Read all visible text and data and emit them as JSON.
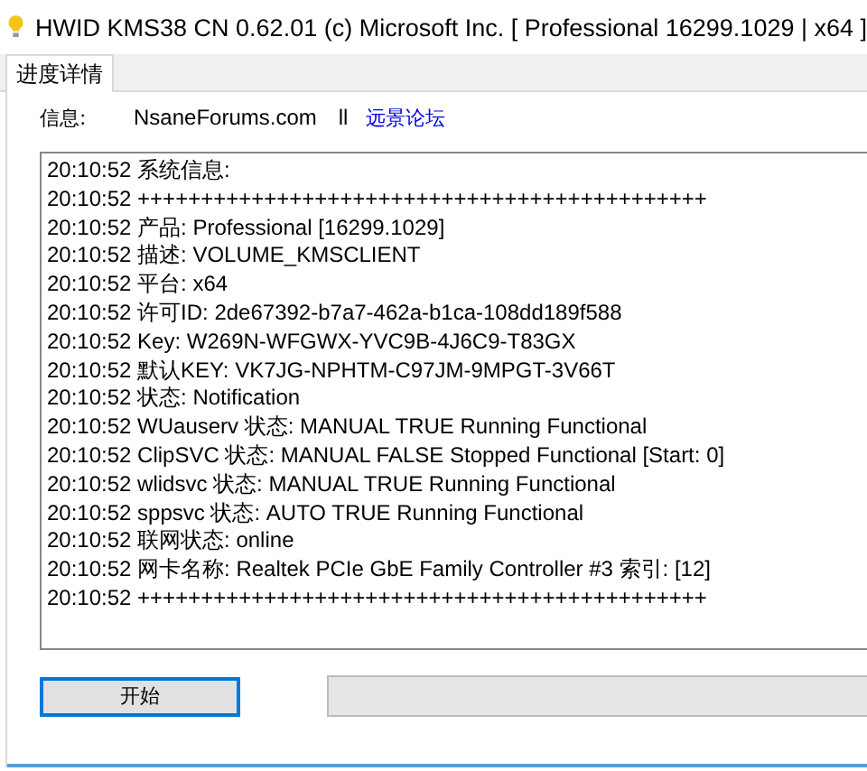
{
  "window": {
    "title": "HWID KMS38 CN 0.62.01 (c) Microsoft Inc. [ Professional 16299.1029 | x64 ]"
  },
  "tabs": [
    {
      "label": "进度详情",
      "selected": true
    }
  ],
  "info": {
    "label": "信息:",
    "site": "NsaneForums.com",
    "separator": "ll",
    "link": "远景论坛"
  },
  "log": [
    "20:10:52 系统信息:",
    "20:10:52 +++++++++++++++++++++++++++++++++++++++++++++",
    "20:10:52 产品: Professional [16299.1029]",
    "20:10:52 描述: VOLUME_KMSCLIENT",
    "20:10:52 平台: x64",
    "20:10:52 许可ID: 2de67392-b7a7-462a-b1ca-108dd189f588",
    "20:10:52 Key: W269N-WFGWX-YVC9B-4J6C9-T83GX",
    "20:10:52 默认KEY: VK7JG-NPHTM-C97JM-9MPGT-3V66T",
    "20:10:52 状态: Notification",
    "20:10:52 WUauserv 状态: MANUAL TRUE Running Functional",
    "20:10:52 ClipSVC 状态: MANUAL FALSE Stopped Functional [Start: 0]",
    "20:10:52 wlidsvc 状态: MANUAL TRUE Running Functional",
    "20:10:52 sppsvc 状态: AUTO TRUE Running Functional",
    "20:10:52 联网状态: online",
    "20:10:52 网卡名称: Realtek PCIe GbE Family Controller #3 索引: [12]",
    "20:10:52 +++++++++++++++++++++++++++++++++++++++++++++"
  ],
  "start_button": {
    "label": "开始"
  },
  "progress": {
    "level": 0
  }
}
